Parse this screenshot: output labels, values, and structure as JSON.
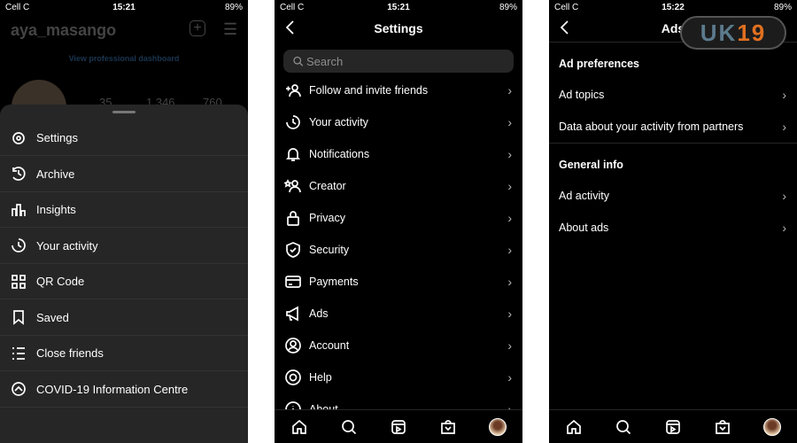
{
  "screens": [
    {
      "status": {
        "carrier": "Cell C",
        "time": "15:21",
        "battery": "89%"
      },
      "profile": {
        "username": "aya_masango",
        "dashboard_link": "View professional dashboard",
        "stats": [
          "35",
          "1,346",
          "760"
        ]
      },
      "menu": [
        {
          "label": "Settings",
          "icon": "gear-icon"
        },
        {
          "label": "Archive",
          "icon": "archive-icon"
        },
        {
          "label": "Insights",
          "icon": "insights-icon"
        },
        {
          "label": "Your activity",
          "icon": "activity-icon"
        },
        {
          "label": "QR Code",
          "icon": "qr-code-icon"
        },
        {
          "label": "Saved",
          "icon": "bookmark-icon"
        },
        {
          "label": "Close friends",
          "icon": "list-icon"
        },
        {
          "label": "COVID-19 Information Centre",
          "icon": "covid-info-icon"
        }
      ]
    },
    {
      "status": {
        "carrier": "Cell C",
        "time": "15:21",
        "battery": "89%"
      },
      "title": "Settings",
      "search_placeholder": "Search",
      "items": [
        {
          "label": "Follow and invite friends",
          "icon": "add-person-icon"
        },
        {
          "label": "Your activity",
          "icon": "activity-icon"
        },
        {
          "label": "Notifications",
          "icon": "bell-icon"
        },
        {
          "label": "Creator",
          "icon": "creator-icon"
        },
        {
          "label": "Privacy",
          "icon": "lock-icon"
        },
        {
          "label": "Security",
          "icon": "shield-icon"
        },
        {
          "label": "Payments",
          "icon": "card-icon"
        },
        {
          "label": "Ads",
          "icon": "megaphone-icon"
        },
        {
          "label": "Account",
          "icon": "account-icon"
        },
        {
          "label": "Help",
          "icon": "lifebuoy-icon"
        },
        {
          "label": "About",
          "icon": "info-icon"
        }
      ]
    },
    {
      "status": {
        "carrier": "Cell C",
        "time": "15:22",
        "battery": "89%"
      },
      "title": "Ads",
      "watermark": "UK19",
      "sections": [
        {
          "heading": "Ad preferences",
          "items": [
            "Ad topics",
            "Data about your activity from partners"
          ]
        },
        {
          "heading": "General info",
          "items": [
            "Ad activity",
            "About ads"
          ]
        }
      ]
    }
  ],
  "nav": [
    "home-icon",
    "search-icon",
    "reels-icon",
    "shop-icon",
    "profile-avatar"
  ]
}
